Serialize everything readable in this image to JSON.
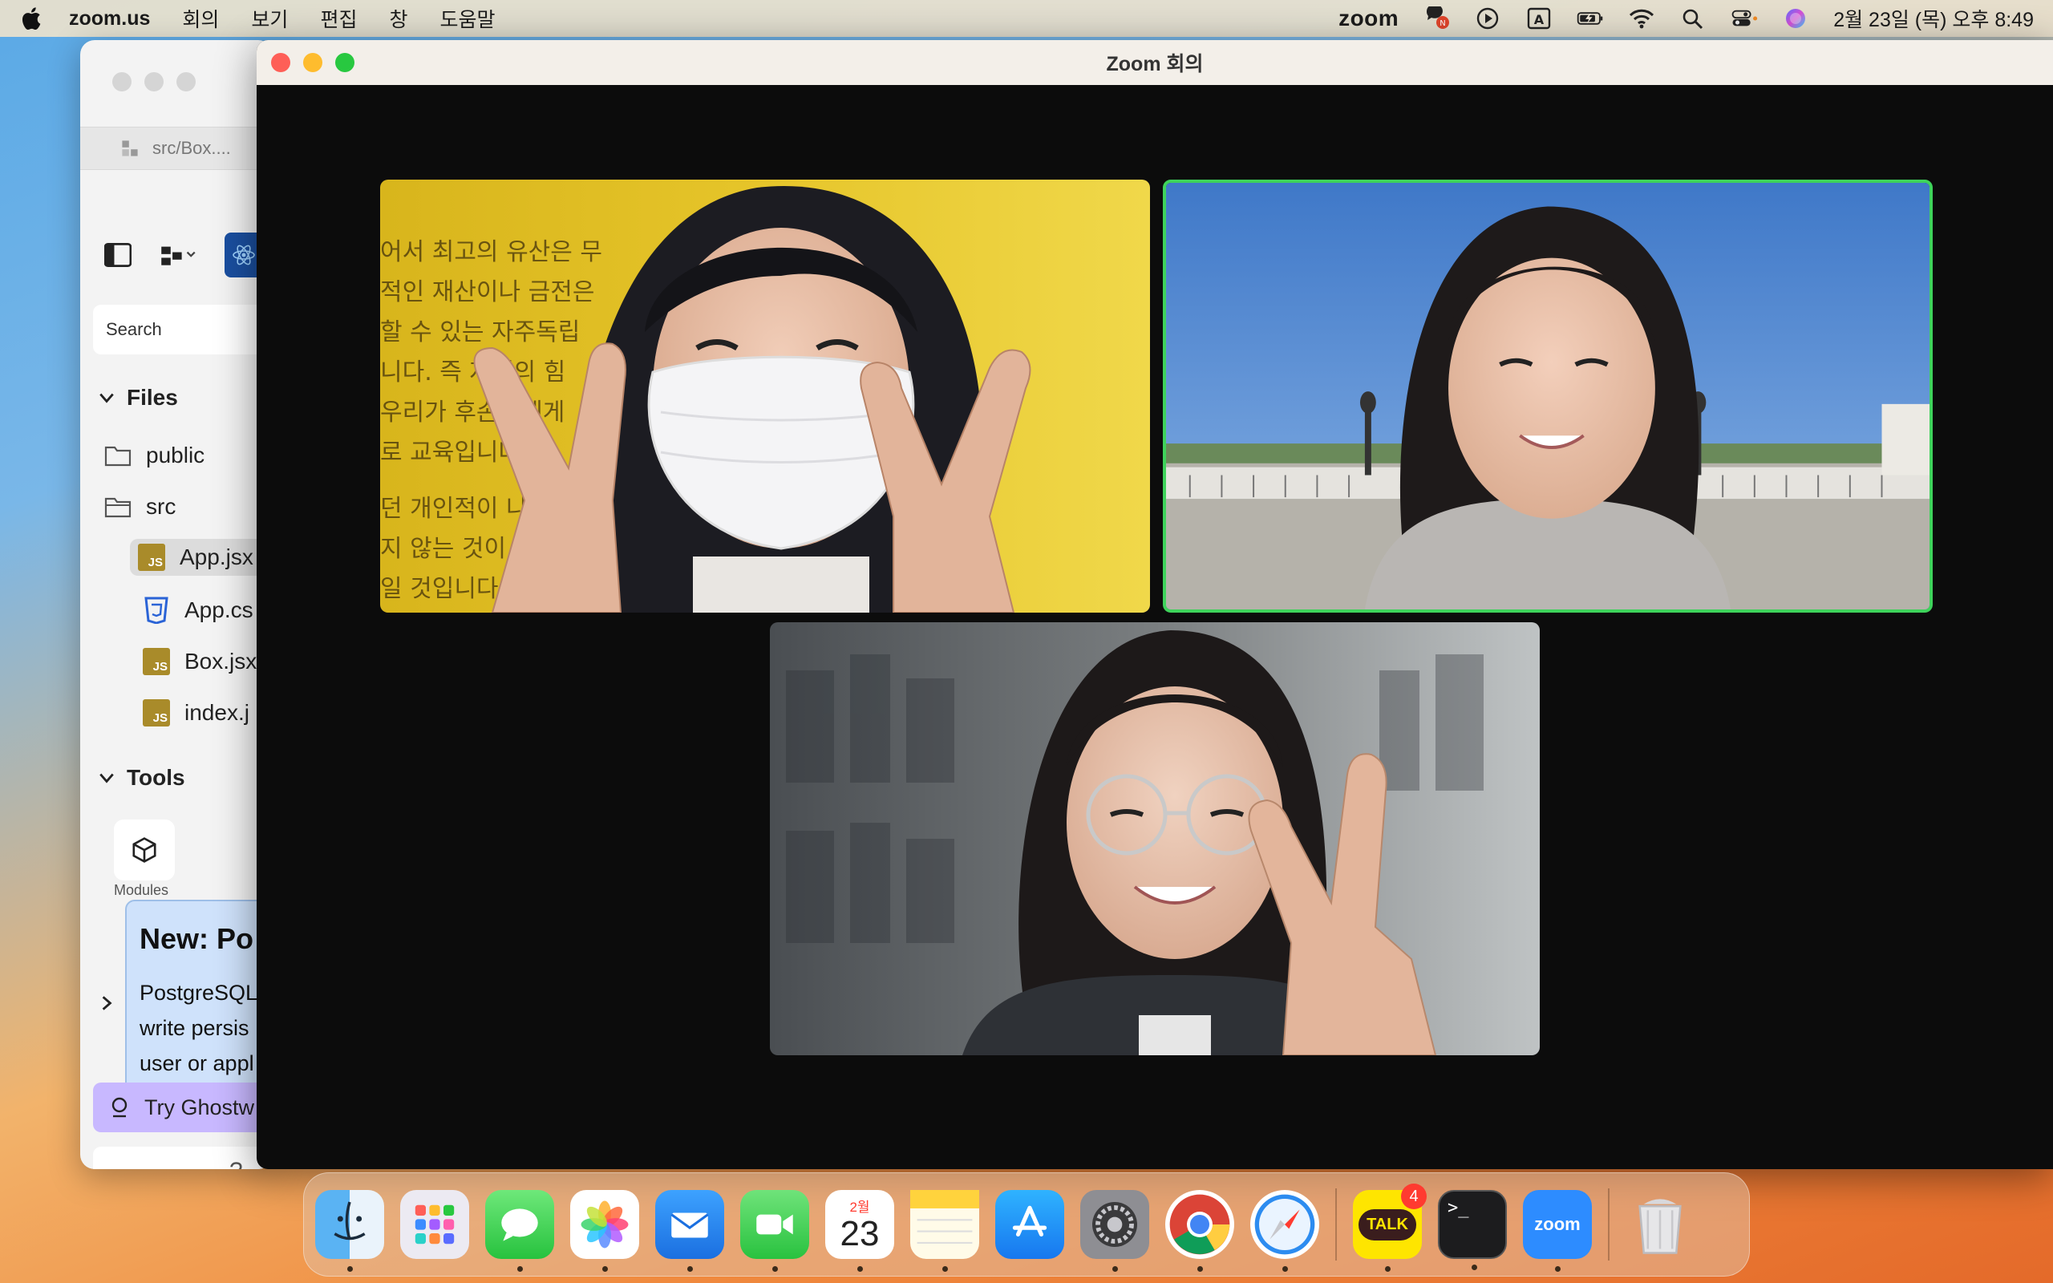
{
  "menubar": {
    "app_name": "zoom.us",
    "menus": [
      "회의",
      "보기",
      "편집",
      "창",
      "도움말"
    ],
    "zoom_word": "zoom",
    "input_indicator": "A",
    "clock": "2월 23일 (목) 오후 8:49"
  },
  "editor": {
    "tab_label": "src/Box....",
    "search_placeholder": "Search",
    "files_section": "Files",
    "tools_section": "Tools",
    "items": {
      "public": "public",
      "src": "src",
      "app_jsx": "App.jsx",
      "app_css": "App.cs",
      "box_jsx": "Box.jsx",
      "index_js": "index.j"
    },
    "tool_label": "Modules",
    "popup": {
      "title": "New: Po",
      "line1": "PostgreSQL",
      "line2": "write persis",
      "line3": "user or appl"
    },
    "try_button": "Try Ghostw",
    "help": "?"
  },
  "zoom": {
    "title": "Zoom 회의",
    "participants": [
      {
        "id": "p1",
        "active": false
      },
      {
        "id": "p2",
        "active": true
      },
      {
        "id": "p3",
        "active": false
      }
    ],
    "sign_text": [
      "어서 최고의 유산은 무",
      "적인 재산이나 금전은",
      "할 수 있는 자주독립",
      "니다. 즉 자생의 힘",
      "우리가 후손들에게",
      "로 교육입니다.",
      "던 개인적이 나",
      "지 않는 것이 바서",
      "일 것입니다"
    ]
  },
  "dock": {
    "apps": [
      {
        "name": "Finder",
        "running": true
      },
      {
        "name": "Launchpad",
        "running": false
      },
      {
        "name": "Messages",
        "running": true
      },
      {
        "name": "Photos",
        "running": true
      },
      {
        "name": "Mail",
        "running": true
      },
      {
        "name": "FaceTime",
        "running": true
      },
      {
        "name": "Calendar",
        "running": true
      },
      {
        "name": "Notes",
        "running": true
      },
      {
        "name": "App Store",
        "running": false
      },
      {
        "name": "System Settings",
        "running": true
      },
      {
        "name": "Chrome",
        "running": true
      },
      {
        "name": "Safari",
        "running": true
      },
      {
        "name": "KakaoTalk",
        "running": true
      },
      {
        "name": "Terminal",
        "running": true
      },
      {
        "name": "Zoom",
        "running": true
      },
      {
        "name": "Trash",
        "running": false
      }
    ],
    "calendar_month": "2월",
    "calendar_day": "23",
    "kakao_label": "TALK",
    "kakao_badge": "4",
    "zoom_label": "zoom",
    "terminal_prompt": ">_"
  }
}
